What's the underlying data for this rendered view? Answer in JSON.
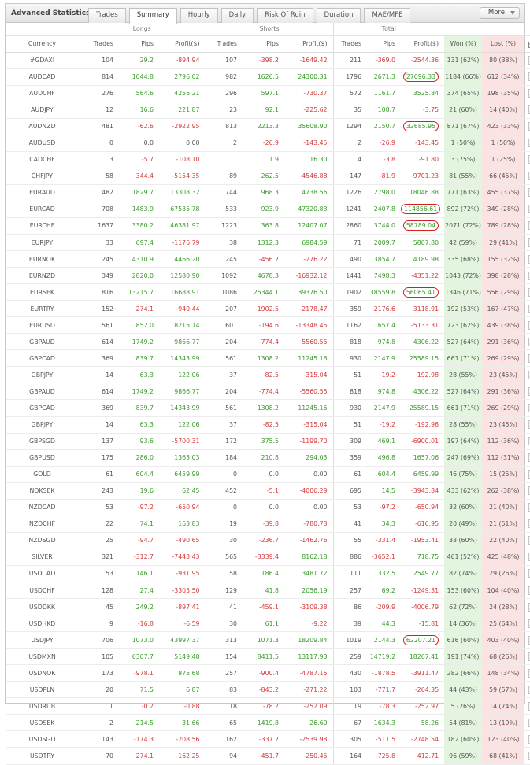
{
  "window": {
    "title": "Advanced Statistics",
    "tabs": [
      "Trades",
      "Summary",
      "Hourly",
      "Daily",
      "Risk Of Ruin",
      "Duration",
      "MAE/MFE"
    ],
    "active_tab": "Summary",
    "more_label": "More"
  },
  "colors": {
    "positive": "#3a9a2a",
    "negative": "#d43a3a",
    "won_bg": "#e3f5df",
    "lost_bg": "#fbe3e3",
    "highlight": "#d62020"
  },
  "groups": {
    "longs": "Longs",
    "shorts": "Shorts",
    "total": "Total"
  },
  "headers": {
    "currency": "Currency",
    "long_trades": "Trades",
    "long_pips": "Pips",
    "long_profit": "Profit($)",
    "short_trades": "Trades",
    "short_pips": "Pips",
    "short_profit": "Profit($)",
    "total_trades": "Trades",
    "total_pips": "Pips",
    "total_profit": "Profit($)",
    "won": "Won (%)",
    "lost": "Lost (%)"
  },
  "rows": [
    {
      "currency": "#GDAXI",
      "lt": "104",
      "lp": "29.2",
      "lpr": "-894.94",
      "st": "107",
      "sp": "-398.2",
      "spr": "-1649.42",
      "tt": "211",
      "tp": "-369.0",
      "tpr": "-2544.36",
      "won": "131 (62%)",
      "lost": "80 (38%)",
      "marked": false,
      "circled": false
    },
    {
      "currency": "AUDCAD",
      "lt": "814",
      "lp": "1044.8",
      "lpr": "2796.02",
      "st": "982",
      "sp": "1626.5",
      "spr": "24300.31",
      "tt": "1796",
      "tp": "2671.3",
      "tpr": "27096.33",
      "won": "1184 (66%)",
      "lost": "612 (34%)",
      "marked": true,
      "circled": true
    },
    {
      "currency": "AUDCHF",
      "lt": "276",
      "lp": "564.6",
      "lpr": "4256.21",
      "st": "296",
      "sp": "597.1",
      "spr": "-730.37",
      "tt": "572",
      "tp": "1161.7",
      "tpr": "3525.84",
      "won": "374 (65%)",
      "lost": "198 (35%)",
      "marked": false,
      "circled": false
    },
    {
      "currency": "AUDJPY",
      "lt": "12",
      "lp": "16.6",
      "lpr": "221.87",
      "st": "23",
      "sp": "92.1",
      "spr": "-225.62",
      "tt": "35",
      "tp": "108.7",
      "tpr": "-3.75",
      "won": "21 (60%)",
      "lost": "14 (40%)",
      "marked": false,
      "circled": false
    },
    {
      "currency": "AUDNZD",
      "lt": "481",
      "lp": "-62.6",
      "lpr": "-2922.95",
      "st": "813",
      "sp": "2213.3",
      "spr": "35608.90",
      "tt": "1294",
      "tp": "2150.7",
      "tpr": "32685.95",
      "won": "871 (67%)",
      "lost": "423 (33%)",
      "marked": false,
      "circled": true
    },
    {
      "currency": "AUDUSD",
      "lt": "0",
      "lp": "0.0",
      "lpr": "0.00",
      "st": "2",
      "sp": "-26.9",
      "spr": "-143.45",
      "tt": "2",
      "tp": "-26.9",
      "tpr": "-143.45",
      "won": "1 (50%)",
      "lost": "1 (50%)",
      "marked": false,
      "circled": false
    },
    {
      "currency": "CADCHF",
      "lt": "3",
      "lp": "-5.7",
      "lpr": "-108.10",
      "st": "1",
      "sp": "1.9",
      "spr": "16.30",
      "tt": "4",
      "tp": "-3.8",
      "tpr": "-91.80",
      "won": "3 (75%)",
      "lost": "1 (25%)",
      "marked": false,
      "circled": false
    },
    {
      "currency": "CHFJPY",
      "lt": "58",
      "lp": "-344.4",
      "lpr": "-5154.35",
      "st": "89",
      "sp": "262.5",
      "spr": "-4546.88",
      "tt": "147",
      "tp": "-81.9",
      "tpr": "-9701.23",
      "won": "81 (55%)",
      "lost": "66 (45%)",
      "marked": false,
      "circled": false
    },
    {
      "currency": "EURAUD",
      "lt": "482",
      "lp": "1829.7",
      "lpr": "13308.32",
      "st": "744",
      "sp": "968.3",
      "spr": "4738.56",
      "tt": "1226",
      "tp": "2798.0",
      "tpr": "18046.88",
      "won": "771 (63%)",
      "lost": "455 (37%)",
      "marked": false,
      "circled": false
    },
    {
      "currency": "EURCAD",
      "lt": "708",
      "lp": "1483.9",
      "lpr": "67535.78",
      "st": "533",
      "sp": "923.9",
      "spr": "47320.83",
      "tt": "1241",
      "tp": "2407.8",
      "tpr": "114856.61",
      "won": "892 (72%)",
      "lost": "349 (28%)",
      "marked": true,
      "circled": true
    },
    {
      "currency": "EURCHF",
      "lt": "1637",
      "lp": "3380.2",
      "lpr": "46381.97",
      "st": "1223",
      "sp": "363.8",
      "spr": "12407.07",
      "tt": "2860",
      "tp": "3744.0",
      "tpr": "58789.04",
      "won": "2071 (72%)",
      "lost": "789 (28%)",
      "marked": true,
      "circled": true
    },
    {
      "currency": "EURJPY",
      "lt": "33",
      "lp": "697.4",
      "lpr": "-1176.79",
      "st": "38",
      "sp": "1312.3",
      "spr": "6984.59",
      "tt": "71",
      "tp": "2009.7",
      "tpr": "5807.80",
      "won": "42 (59%)",
      "lost": "29 (41%)",
      "marked": false,
      "circled": false
    },
    {
      "currency": "EURNOK",
      "lt": "245",
      "lp": "4310.9",
      "lpr": "4466.20",
      "st": "245",
      "sp": "-456.2",
      "spr": "-276.22",
      "tt": "490",
      "tp": "3854.7",
      "tpr": "4189.98",
      "won": "335 (68%)",
      "lost": "155 (32%)",
      "marked": false,
      "circled": false
    },
    {
      "currency": "EURNZD",
      "lt": "349",
      "lp": "2820.0",
      "lpr": "12580.90",
      "st": "1092",
      "sp": "4678.3",
      "spr": "-16932.12",
      "tt": "1441",
      "tp": "7498.3",
      "tpr": "-4351.22",
      "won": "1043 (72%)",
      "lost": "398 (28%)",
      "marked": false,
      "circled": false
    },
    {
      "currency": "EURSEK",
      "lt": "816",
      "lp": "13215.7",
      "lpr": "16688.91",
      "st": "1086",
      "sp": "25344.1",
      "spr": "39376.50",
      "tt": "1902",
      "tp": "38559.8",
      "tpr": "56065.41",
      "won": "1346 (71%)",
      "lost": "556 (29%)",
      "marked": true,
      "circled": true
    },
    {
      "currency": "EURTRY",
      "lt": "152",
      "lp": "-274.1",
      "lpr": "-940.44",
      "st": "207",
      "sp": "-1902.5",
      "spr": "-2178.47",
      "tt": "359",
      "tp": "-2176.6",
      "tpr": "-3118.91",
      "won": "192 (53%)",
      "lost": "167 (47%)",
      "marked": false,
      "circled": false
    },
    {
      "currency": "EURUSD",
      "lt": "561",
      "lp": "852.0",
      "lpr": "8215.14",
      "st": "601",
      "sp": "-194.6",
      "spr": "-13348.45",
      "tt": "1162",
      "tp": "657.4",
      "tpr": "-5133.31",
      "won": "723 (62%)",
      "lost": "439 (38%)",
      "marked": false,
      "circled": false
    },
    {
      "currency": "GBPAUD",
      "lt": "614",
      "lp": "1749.2",
      "lpr": "9866.77",
      "st": "204",
      "sp": "-774.4",
      "spr": "-5560.55",
      "tt": "818",
      "tp": "974.8",
      "tpr": "4306.22",
      "won": "527 (64%)",
      "lost": "291 (36%)",
      "marked": false,
      "circled": false
    },
    {
      "currency": "GBPCAD",
      "lt": "369",
      "lp": "839.7",
      "lpr": "14343.99",
      "st": "561",
      "sp": "1308.2",
      "spr": "11245.16",
      "tt": "930",
      "tp": "2147.9",
      "tpr": "25589.15",
      "won": "661 (71%)",
      "lost": "269 (29%)",
      "marked": false,
      "circled": false
    },
    {
      "currency": "GBPJPY",
      "lt": "14",
      "lp": "63.3",
      "lpr": "122.06",
      "st": "37",
      "sp": "-82.5",
      "spr": "-315.04",
      "tt": "51",
      "tp": "-19.2",
      "tpr": "-192.98",
      "won": "28 (55%)",
      "lost": "23 (45%)",
      "marked": false,
      "circled": false
    },
    {
      "currency": "GBPAUD",
      "lt": "614",
      "lp": "1749.2",
      "lpr": "9866.77",
      "st": "204",
      "sp": "-774.4",
      "spr": "-5560.55",
      "tt": "818",
      "tp": "974.8",
      "tpr": "4306.22",
      "won": "527 (64%)",
      "lost": "291 (36%)",
      "marked": false,
      "circled": false
    },
    {
      "currency": "GBPCAD",
      "lt": "369",
      "lp": "839.7",
      "lpr": "14343.99",
      "st": "561",
      "sp": "1308.2",
      "spr": "11245.16",
      "tt": "930",
      "tp": "2147.9",
      "tpr": "25589.15",
      "won": "661 (71%)",
      "lost": "269 (29%)",
      "marked": false,
      "circled": false
    },
    {
      "currency": "GBPJPY",
      "lt": "14",
      "lp": "63.3",
      "lpr": "122.06",
      "st": "37",
      "sp": "-82.5",
      "spr": "-315.04",
      "tt": "51",
      "tp": "-19.2",
      "tpr": "-192.98",
      "won": "28 (55%)",
      "lost": "23 (45%)",
      "marked": false,
      "circled": false
    },
    {
      "currency": "GBPSGD",
      "lt": "137",
      "lp": "93.6",
      "lpr": "-5700.31",
      "st": "172",
      "sp": "375.5",
      "spr": "-1199.70",
      "tt": "309",
      "tp": "469.1",
      "tpr": "-6900.01",
      "won": "197 (64%)",
      "lost": "112 (36%)",
      "marked": false,
      "circled": false
    },
    {
      "currency": "GBPUSD",
      "lt": "175",
      "lp": "286.0",
      "lpr": "1363.03",
      "st": "184",
      "sp": "210.8",
      "spr": "294.03",
      "tt": "359",
      "tp": "496.8",
      "tpr": "1657.06",
      "won": "247 (69%)",
      "lost": "112 (31%)",
      "marked": false,
      "circled": false
    },
    {
      "currency": "GOLD",
      "lt": "61",
      "lp": "604.4",
      "lpr": "6459.99",
      "st": "0",
      "sp": "0.0",
      "spr": "0.00",
      "tt": "61",
      "tp": "604.4",
      "tpr": "6459.99",
      "won": "46 (75%)",
      "lost": "15 (25%)",
      "marked": false,
      "circled": false
    },
    {
      "currency": "NOKSEK",
      "lt": "243",
      "lp": "19.6",
      "lpr": "62.45",
      "st": "452",
      "sp": "-5.1",
      "spr": "-4006.29",
      "tt": "695",
      "tp": "14.5",
      "tpr": "-3943.84",
      "won": "433 (62%)",
      "lost": "262 (38%)",
      "marked": false,
      "circled": false
    },
    {
      "currency": "NZDCAD",
      "lt": "53",
      "lp": "-97.2",
      "lpr": "-650.94",
      "st": "0",
      "sp": "0.0",
      "spr": "0.00",
      "tt": "53",
      "tp": "-97.2",
      "tpr": "-650.94",
      "won": "32 (60%)",
      "lost": "21 (40%)",
      "marked": false,
      "circled": false
    },
    {
      "currency": "NZDCHF",
      "lt": "22",
      "lp": "74.1",
      "lpr": "163.83",
      "st": "19",
      "sp": "-39.8",
      "spr": "-780.78",
      "tt": "41",
      "tp": "34.3",
      "tpr": "-616.95",
      "won": "20 (49%)",
      "lost": "21 (51%)",
      "marked": false,
      "circled": false
    },
    {
      "currency": "NZDSGD",
      "lt": "25",
      "lp": "-94.7",
      "lpr": "-490.65",
      "st": "30",
      "sp": "-236.7",
      "spr": "-1462.76",
      "tt": "55",
      "tp": "-331.4",
      "tpr": "-1953.41",
      "won": "33 (60%)",
      "lost": "22 (40%)",
      "marked": false,
      "circled": false
    },
    {
      "currency": "SILVER",
      "lt": "321",
      "lp": "-312.7",
      "lpr": "-7443.43",
      "st": "565",
      "sp": "-3339.4",
      "spr": "8162.18",
      "tt": "886",
      "tp": "-3652.1",
      "tpr": "718.75",
      "won": "461 (52%)",
      "lost": "425 (48%)",
      "marked": false,
      "circled": false
    },
    {
      "currency": "USDCAD",
      "lt": "53",
      "lp": "146.1",
      "lpr": "-931.95",
      "st": "58",
      "sp": "186.4",
      "spr": "3481.72",
      "tt": "111",
      "tp": "332.5",
      "tpr": "2549.77",
      "won": "82 (74%)",
      "lost": "29 (26%)",
      "marked": false,
      "circled": false
    },
    {
      "currency": "USDCHF",
      "lt": "128",
      "lp": "27.4",
      "lpr": "-3305.50",
      "st": "129",
      "sp": "41.8",
      "spr": "2056.19",
      "tt": "257",
      "tp": "69.2",
      "tpr": "-1249.31",
      "won": "153 (60%)",
      "lost": "104 (40%)",
      "marked": false,
      "circled": false
    },
    {
      "currency": "USDDKK",
      "lt": "45",
      "lp": "249.2",
      "lpr": "-897.41",
      "st": "41",
      "sp": "-459.1",
      "spr": "-3109.38",
      "tt": "86",
      "tp": "-209.9",
      "tpr": "-4006.79",
      "won": "62 (72%)",
      "lost": "24 (28%)",
      "marked": false,
      "circled": false
    },
    {
      "currency": "USDHKD",
      "lt": "9",
      "lp": "-16.8",
      "lpr": "-6.59",
      "st": "30",
      "sp": "61.1",
      "spr": "-9.22",
      "tt": "39",
      "tp": "44.3",
      "tpr": "-15.81",
      "won": "14 (36%)",
      "lost": "25 (64%)",
      "marked": false,
      "circled": false
    },
    {
      "currency": "USDJPY",
      "lt": "706",
      "lp": "1073.0",
      "lpr": "43997.37",
      "st": "313",
      "sp": "1071.3",
      "spr": "18209.84",
      "tt": "1019",
      "tp": "2144.3",
      "tpr": "62207.21",
      "won": "616 (60%)",
      "lost": "403 (40%)",
      "marked": true,
      "circled": true
    },
    {
      "currency": "USDMXN",
      "lt": "105",
      "lp": "6307.7",
      "lpr": "5149.48",
      "st": "154",
      "sp": "8411.5",
      "spr": "13117.93",
      "tt": "259",
      "tp": "14719.2",
      "tpr": "18267.41",
      "won": "191 (74%)",
      "lost": "68 (26%)",
      "marked": false,
      "circled": false
    },
    {
      "currency": "USDNOK",
      "lt": "173",
      "lp": "-978.1",
      "lpr": "875.68",
      "st": "257",
      "sp": "-900.4",
      "spr": "-4787.15",
      "tt": "430",
      "tp": "-1878.5",
      "tpr": "-3911.47",
      "won": "282 (66%)",
      "lost": "148 (34%)",
      "marked": false,
      "circled": false
    },
    {
      "currency": "USDPLN",
      "lt": "20",
      "lp": "71.5",
      "lpr": "6.87",
      "st": "83",
      "sp": "-843.2",
      "spr": "-271.22",
      "tt": "103",
      "tp": "-771.7",
      "tpr": "-264.35",
      "won": "44 (43%)",
      "lost": "59 (57%)",
      "marked": false,
      "circled": false
    },
    {
      "currency": "USDRUB",
      "lt": "1",
      "lp": "-0.2",
      "lpr": "-0.88",
      "st": "18",
      "sp": "-78.2",
      "spr": "-252.09",
      "tt": "19",
      "tp": "-78.3",
      "tpr": "-252.97",
      "won": "5 (26%)",
      "lost": "14 (74%)",
      "marked": false,
      "circled": false
    },
    {
      "currency": "USDSEK",
      "lt": "2",
      "lp": "214.5",
      "lpr": "31.66",
      "st": "65",
      "sp": "1419.8",
      "spr": "26.60",
      "tt": "67",
      "tp": "1634.3",
      "tpr": "58.26",
      "won": "54 (81%)",
      "lost": "13 (19%)",
      "marked": false,
      "circled": false
    },
    {
      "currency": "USDSGD",
      "lt": "143",
      "lp": "-174.3",
      "lpr": "-208.56",
      "st": "162",
      "sp": "-337.2",
      "spr": "-2539.98",
      "tt": "305",
      "tp": "-511.5",
      "tpr": "-2748.54",
      "won": "182 (60%)",
      "lost": "123 (40%)",
      "marked": false,
      "circled": false
    },
    {
      "currency": "USDTRY",
      "lt": "70",
      "lp": "-274.1",
      "lpr": "-162.25",
      "st": "94",
      "sp": "-451.7",
      "spr": "-250.46",
      "tt": "164",
      "tp": "-725.8",
      "tpr": "-412.71",
      "won": "96 (59%)",
      "lost": "68 (41%)",
      "marked": false,
      "circled": false
    }
  ]
}
